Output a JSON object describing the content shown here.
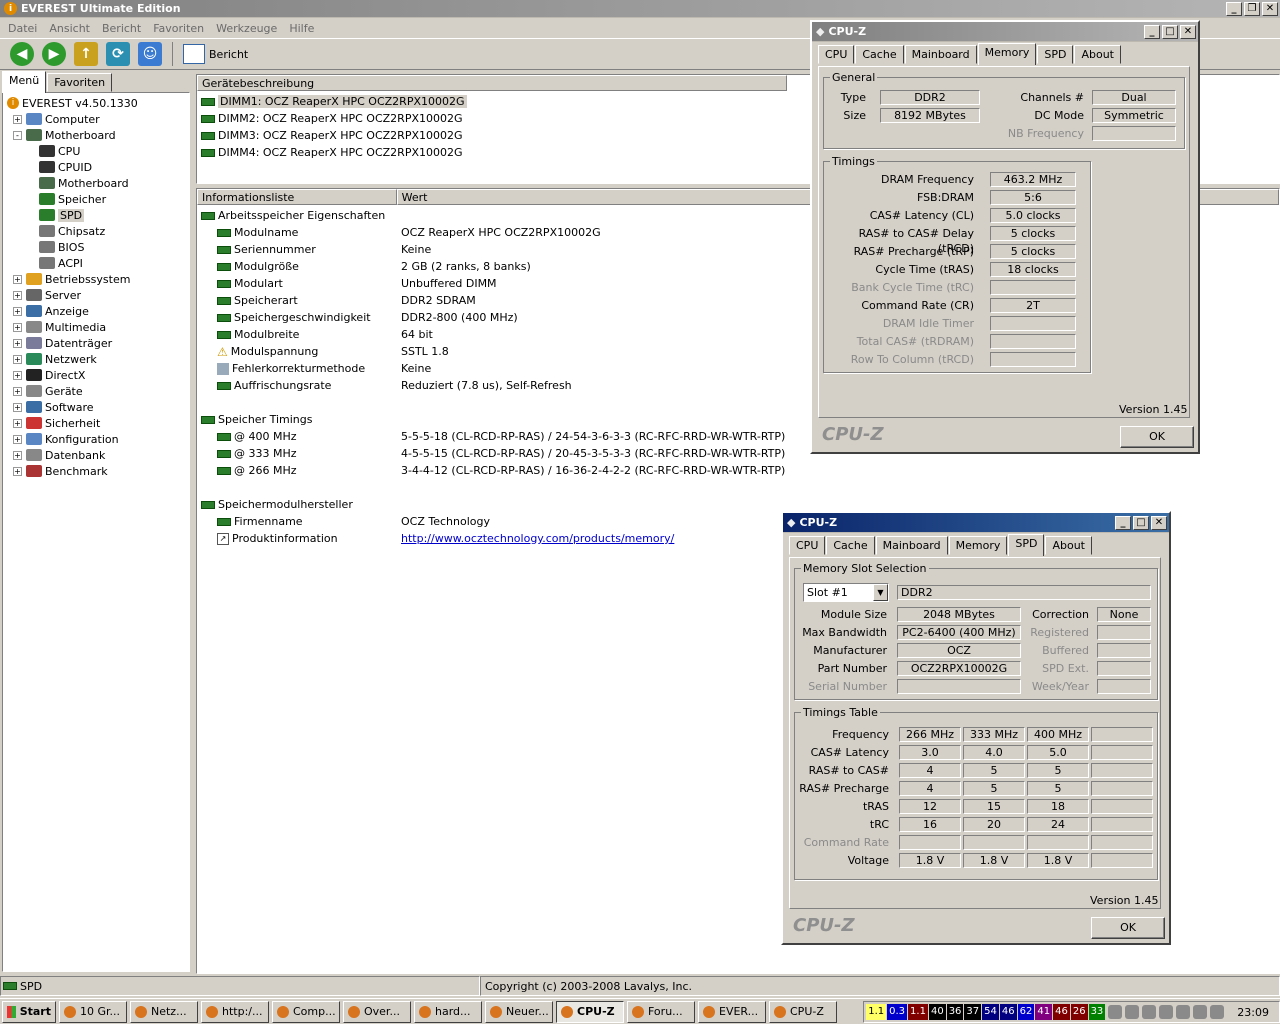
{
  "everest": {
    "title": "EVEREST Ultimate Edition",
    "menu": [
      "Datei",
      "Ansicht",
      "Bericht",
      "Favoriten",
      "Werkzeuge",
      "Hilfe"
    ],
    "toolbar_report": "Bericht",
    "side_tabs": [
      "Menü",
      "Favoriten"
    ],
    "tree": [
      {
        "label": "EVEREST v4.50.1330",
        "level": 0,
        "icon": "info-icon",
        "exp": ""
      },
      {
        "label": "Computer",
        "level": 1,
        "icon": "computer-icon",
        "exp": "+"
      },
      {
        "label": "Motherboard",
        "level": 1,
        "icon": "motherboard-icon",
        "exp": "-"
      },
      {
        "label": "CPU",
        "level": 2,
        "icon": "cpu-icon",
        "exp": ""
      },
      {
        "label": "CPUID",
        "level": 2,
        "icon": "cpuid-icon",
        "exp": ""
      },
      {
        "label": "Motherboard",
        "level": 2,
        "icon": "motherboard-icon",
        "exp": ""
      },
      {
        "label": "Speicher",
        "level": 2,
        "icon": "memory-icon",
        "exp": ""
      },
      {
        "label": "SPD",
        "level": 2,
        "icon": "memory-icon",
        "exp": "",
        "selected": true
      },
      {
        "label": "Chipsatz",
        "level": 2,
        "icon": "chipset-icon",
        "exp": ""
      },
      {
        "label": "BIOS",
        "level": 2,
        "icon": "bios-icon",
        "exp": ""
      },
      {
        "label": "ACPI",
        "level": 2,
        "icon": "acpi-icon",
        "exp": ""
      },
      {
        "label": "Betriebssystem",
        "level": 1,
        "icon": "windows-icon",
        "exp": "+"
      },
      {
        "label": "Server",
        "level": 1,
        "icon": "server-icon",
        "exp": "+"
      },
      {
        "label": "Anzeige",
        "level": 1,
        "icon": "display-icon",
        "exp": "+"
      },
      {
        "label": "Multimedia",
        "level": 1,
        "icon": "multimedia-icon",
        "exp": "+"
      },
      {
        "label": "Datenträger",
        "level": 1,
        "icon": "storage-icon",
        "exp": "+"
      },
      {
        "label": "Netzwerk",
        "level": 1,
        "icon": "network-icon",
        "exp": "+"
      },
      {
        "label": "DirectX",
        "level": 1,
        "icon": "directx-icon",
        "exp": "+"
      },
      {
        "label": "Geräte",
        "level": 1,
        "icon": "devices-icon",
        "exp": "+"
      },
      {
        "label": "Software",
        "level": 1,
        "icon": "software-icon",
        "exp": "+"
      },
      {
        "label": "Sicherheit",
        "level": 1,
        "icon": "security-icon",
        "exp": "+"
      },
      {
        "label": "Konfiguration",
        "level": 1,
        "icon": "config-icon",
        "exp": "+"
      },
      {
        "label": "Datenbank",
        "level": 1,
        "icon": "database-icon",
        "exp": "+"
      },
      {
        "label": "Benchmark",
        "level": 1,
        "icon": "benchmark-icon",
        "exp": "+"
      }
    ],
    "device_header": "Gerätebeschreibung",
    "devices": [
      "DIMM1: OCZ ReaperX HPC OCZ2RPX10002G",
      "DIMM2: OCZ ReaperX HPC OCZ2RPX10002G",
      "DIMM3: OCZ ReaperX HPC OCZ2RPX10002G",
      "DIMM4: OCZ ReaperX HPC OCZ2RPX10002G"
    ],
    "info_headers": [
      "Informationsliste",
      "Wert"
    ],
    "info_rows": [
      {
        "type": "section",
        "label": "Arbeitsspeicher Eigenschaften"
      },
      {
        "type": "item",
        "label": "Modulname",
        "value": "OCZ ReaperX HPC OCZ2RPX10002G"
      },
      {
        "type": "item",
        "label": "Seriennummer",
        "value": "Keine"
      },
      {
        "type": "item",
        "label": "Modulgröße",
        "value": "2 GB (2 ranks, 8 banks)"
      },
      {
        "type": "item",
        "label": "Modulart",
        "value": "Unbuffered DIMM"
      },
      {
        "type": "item",
        "label": "Speicherart",
        "value": "DDR2 SDRAM"
      },
      {
        "type": "item",
        "label": "Speichergeschwindigkeit",
        "value": "DDR2-800 (400 MHz)"
      },
      {
        "type": "item",
        "label": "Modulbreite",
        "value": "64 bit"
      },
      {
        "type": "item",
        "label": "Modulspannung",
        "value": "SSTL 1.8",
        "icon": "warning"
      },
      {
        "type": "item",
        "label": "Fehlerkorrekturmethode",
        "value": "Keine",
        "icon": "box"
      },
      {
        "type": "item",
        "label": "Auffrischungsrate",
        "value": "Reduziert (7.8 us), Self-Refresh"
      },
      {
        "type": "blank"
      },
      {
        "type": "section",
        "label": "Speicher Timings"
      },
      {
        "type": "item",
        "label": "@ 400 MHz",
        "value": "5-5-5-18  (CL-RCD-RP-RAS) / 24-54-3-6-3-3  (RC-RFC-RRD-WR-WTR-RTP)"
      },
      {
        "type": "item",
        "label": "@ 333 MHz",
        "value": "4-5-5-15  (CL-RCD-RP-RAS) / 20-45-3-5-3-3  (RC-RFC-RRD-WR-WTR-RTP)"
      },
      {
        "type": "item",
        "label": "@ 266 MHz",
        "value": "3-4-4-12  (CL-RCD-RP-RAS) / 16-36-2-4-2-2  (RC-RFC-RRD-WR-WTR-RTP)"
      },
      {
        "type": "blank"
      },
      {
        "type": "section",
        "label": "Speichermodulhersteller"
      },
      {
        "type": "item",
        "label": "Firmenname",
        "value": "OCZ Technology"
      },
      {
        "type": "item",
        "label": "Produktinformation",
        "value": "http://www.ocztechnology.com/products/memory/",
        "link": true,
        "icon": "link"
      }
    ],
    "status_left": "SPD",
    "status_right": "Copyright (c) 2003-2008 Lavalys, Inc."
  },
  "cpuz_memory": {
    "title": "CPU-Z",
    "tabs": [
      "CPU",
      "Cache",
      "Mainboard",
      "Memory",
      "SPD",
      "About"
    ],
    "active_tab": "Memory",
    "general_label": "General",
    "type_label": "Type",
    "type_value": "DDR2",
    "size_label": "Size",
    "size_value": "8192 MBytes",
    "channels_label": "Channels #",
    "channels_value": "Dual",
    "dcmode_label": "DC Mode",
    "dcmode_value": "Symmetric",
    "nbfreq_label": "NB Frequency",
    "nbfreq_value": "",
    "timings_label": "Timings",
    "timings": [
      {
        "label": "DRAM Frequency",
        "value": "463.2 MHz",
        "dis": false
      },
      {
        "label": "FSB:DRAM",
        "value": "5:6",
        "dis": false
      },
      {
        "label": "CAS# Latency (CL)",
        "value": "5.0 clocks",
        "dis": false
      },
      {
        "label": "RAS# to CAS# Delay (tRCD)",
        "value": "5 clocks",
        "dis": false
      },
      {
        "label": "RAS# Precharge (tRP)",
        "value": "5 clocks",
        "dis": false
      },
      {
        "label": "Cycle Time (tRAS)",
        "value": "18 clocks",
        "dis": false
      },
      {
        "label": "Bank Cycle Time (tRC)",
        "value": "",
        "dis": true
      },
      {
        "label": "Command Rate (CR)",
        "value": "2T",
        "dis": false
      },
      {
        "label": "DRAM Idle Timer",
        "value": "",
        "dis": true
      },
      {
        "label": "Total CAS# (tRDRAM)",
        "value": "",
        "dis": true
      },
      {
        "label": "Row To Column (tRCD)",
        "value": "",
        "dis": true
      }
    ],
    "version": "Version 1.45",
    "logo": "CPU-Z",
    "ok": "OK"
  },
  "cpuz_spd": {
    "title": "CPU-Z",
    "tabs": [
      "CPU",
      "Cache",
      "Mainboard",
      "Memory",
      "SPD",
      "About"
    ],
    "active_tab": "SPD",
    "slot_group": "Memory Slot Selection",
    "slot_value": "Slot #1",
    "slot_type": "DDR2",
    "module_size_label": "Module Size",
    "module_size": "2048 MBytes",
    "max_bw_label": "Max Bandwidth",
    "max_bw": "PC2-6400 (400 MHz)",
    "manufacturer_label": "Manufacturer",
    "manufacturer": "OCZ",
    "part_label": "Part Number",
    "part": "OCZ2RPX10002G",
    "serial_label": "Serial Number",
    "serial": "",
    "correction_label": "Correction",
    "correction": "None",
    "registered_label": "Registered",
    "buffered_label": "Buffered",
    "spdext_label": "SPD Ext.",
    "weekyear_label": "Week/Year",
    "timings_group": "Timings Table",
    "table": [
      {
        "label": "Frequency",
        "dis": false,
        "v": [
          "266 MHz",
          "333 MHz",
          "400 MHz",
          ""
        ]
      },
      {
        "label": "CAS# Latency",
        "dis": false,
        "v": [
          "3.0",
          "4.0",
          "5.0",
          ""
        ]
      },
      {
        "label": "RAS# to CAS#",
        "dis": false,
        "v": [
          "4",
          "5",
          "5",
          ""
        ]
      },
      {
        "label": "RAS# Precharge",
        "dis": false,
        "v": [
          "4",
          "5",
          "5",
          ""
        ]
      },
      {
        "label": "tRAS",
        "dis": false,
        "v": [
          "12",
          "15",
          "18",
          ""
        ]
      },
      {
        "label": "tRC",
        "dis": false,
        "v": [
          "16",
          "20",
          "24",
          ""
        ]
      },
      {
        "label": "Command Rate",
        "dis": true,
        "v": [
          "",
          "",
          "",
          ""
        ]
      },
      {
        "label": "Voltage",
        "dis": false,
        "v": [
          "1.8 V",
          "1.8 V",
          "1.8 V",
          ""
        ]
      }
    ],
    "version": "Version 1.45",
    "logo": "CPU-Z",
    "ok": "OK"
  },
  "taskbar": {
    "start": "Start",
    "tasks": [
      {
        "label": "10 Gr...",
        "active": false
      },
      {
        "label": "Netz...",
        "active": false
      },
      {
        "label": "http:/...",
        "active": false
      },
      {
        "label": "Comp...",
        "active": false
      },
      {
        "label": "Over...",
        "active": false
      },
      {
        "label": "hard...",
        "active": false
      },
      {
        "label": "Neuer...",
        "active": false
      },
      {
        "label": "CPU-Z",
        "active": true
      },
      {
        "label": "Foru...",
        "active": false
      },
      {
        "label": "EVER...",
        "active": false
      },
      {
        "label": "CPU-Z",
        "active": false
      }
    ],
    "tray_values": [
      {
        "t": "1.1",
        "bg": "#ffff66",
        "fg": "#000"
      },
      {
        "t": "0.3",
        "bg": "#0000cc",
        "fg": "#fff"
      },
      {
        "t": "1.1",
        "bg": "#800000",
        "fg": "#fff"
      },
      {
        "t": "40",
        "bg": "#000",
        "fg": "#fff"
      },
      {
        "t": "36",
        "bg": "#000",
        "fg": "#fff"
      },
      {
        "t": "37",
        "bg": "#000",
        "fg": "#fff"
      },
      {
        "t": "54",
        "bg": "#000080",
        "fg": "#fff"
      },
      {
        "t": "46",
        "bg": "#000080",
        "fg": "#fff"
      },
      {
        "t": "62",
        "bg": "#0000cc",
        "fg": "#fff"
      },
      {
        "t": "41",
        "bg": "#800080",
        "fg": "#fff"
      },
      {
        "t": "46",
        "bg": "#800000",
        "fg": "#fff"
      },
      {
        "t": "26",
        "bg": "#800000",
        "fg": "#fff"
      },
      {
        "t": "33",
        "bg": "#008000",
        "fg": "#fff"
      }
    ],
    "clock": "23:09"
  }
}
